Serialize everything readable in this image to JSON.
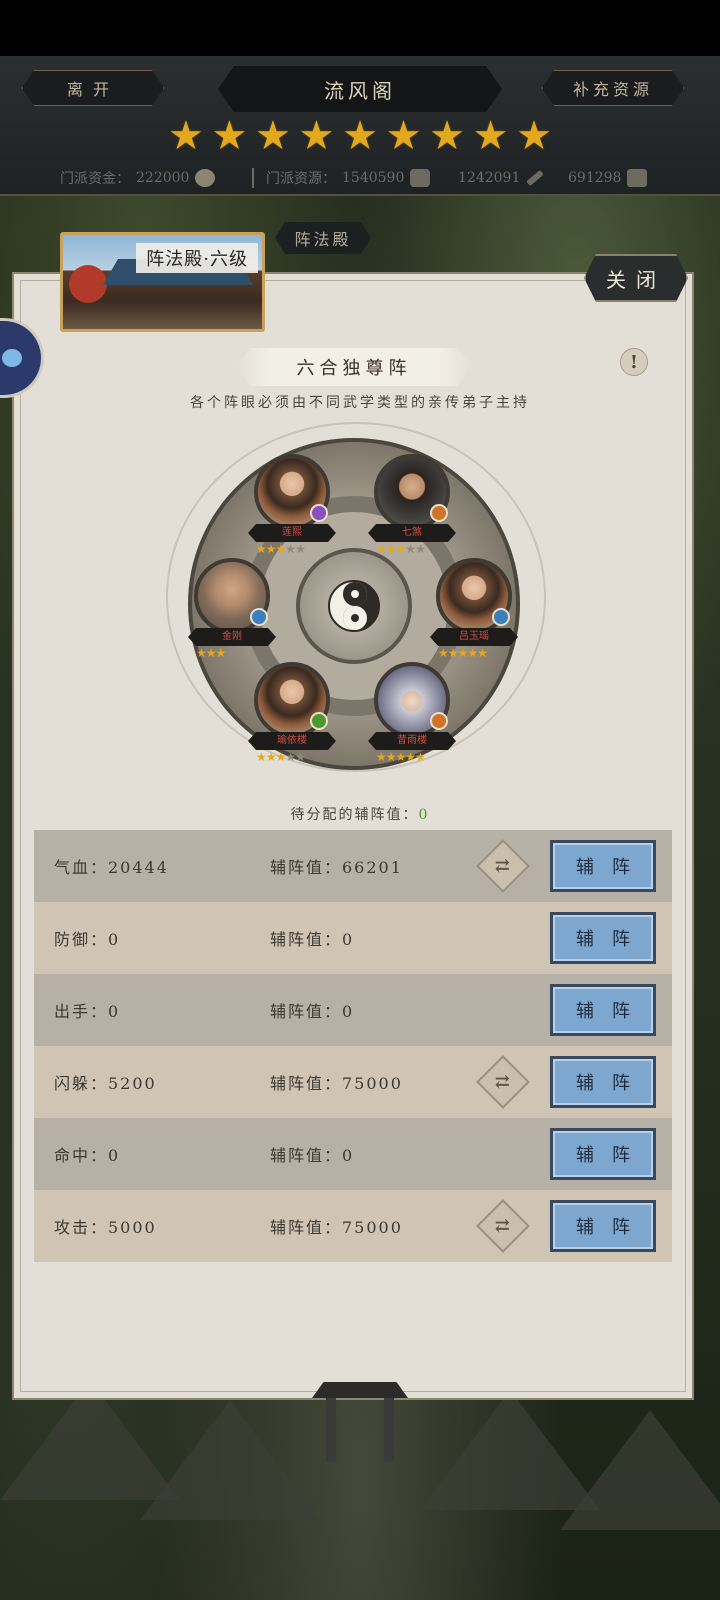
{
  "header": {
    "leave_label": "离开",
    "title": "流风阁",
    "supply_label": "补充资源",
    "star_count": 9,
    "resources": [
      {
        "label": "门派资金：",
        "value": "222000",
        "icon": "coin-icon"
      },
      {
        "label": "门派资源：",
        "value": "1540590",
        "icon": "resource-bag-icon"
      },
      {
        "label": "",
        "value": "1242091",
        "icon": "brush-icon"
      },
      {
        "label": "",
        "value": "691298",
        "icon": "chest-icon"
      }
    ]
  },
  "scene": {
    "label": "阵法殿·六级",
    "tab_label": "阵法殿"
  },
  "panel": {
    "close_label": "关闭",
    "formation_title": "六合独尊阵",
    "subtitle": "各个阵眼必须由不同武学类型的亲传弟子主持",
    "pending_label": "待分配的辅阵值：",
    "pending_value": "0"
  },
  "slots": [
    {
      "name": "莲熙",
      "stars": 3,
      "max_stars": 5,
      "badge_color": "#8a4fbf",
      "portrait": "female"
    },
    {
      "name": "七煞",
      "stars": 3,
      "max_stars": 5,
      "badge_color": "#d0742a",
      "portrait": "male"
    },
    {
      "name": "金刚",
      "stars": 3,
      "max_stars": 5,
      "badge_color": "#3a7fc0",
      "portrait": "bald"
    },
    {
      "name": "吕玉瑶",
      "stars": 5,
      "max_stars": 5,
      "badge_color": "#3a7fc0",
      "portrait": "female"
    },
    {
      "name": "瑜依楼",
      "stars": 3,
      "max_stars": 5,
      "badge_color": "#4a9a2f",
      "portrait": "female"
    },
    {
      "name": "昔雨楼",
      "stars": 5,
      "max_stars": 5,
      "badge_color": "#d0742a",
      "portrait": "hat"
    }
  ],
  "stats": [
    {
      "name": "气血：20444",
      "aux": "辅阵值：66201",
      "has_swap": true,
      "button": "辅阵"
    },
    {
      "name": "防御：0",
      "aux": "辅阵值：0",
      "has_swap": false,
      "button": "辅阵"
    },
    {
      "name": "出手：0",
      "aux": "辅阵值：0",
      "has_swap": false,
      "button": "辅阵"
    },
    {
      "name": "闪躲：5200",
      "aux": "辅阵值：75000",
      "has_swap": true,
      "button": "辅阵"
    },
    {
      "name": "命中：0",
      "aux": "辅阵值：0",
      "has_swap": false,
      "button": "辅阵"
    },
    {
      "name": "攻击：5000",
      "aux": "辅阵值：75000",
      "has_swap": true,
      "button": "辅阵"
    }
  ],
  "colors": {
    "star_gold": "#e3a81e",
    "button_blue": "#7ea7d0",
    "pending_green": "#4a9a2f",
    "name_red": "#d64c3c"
  }
}
